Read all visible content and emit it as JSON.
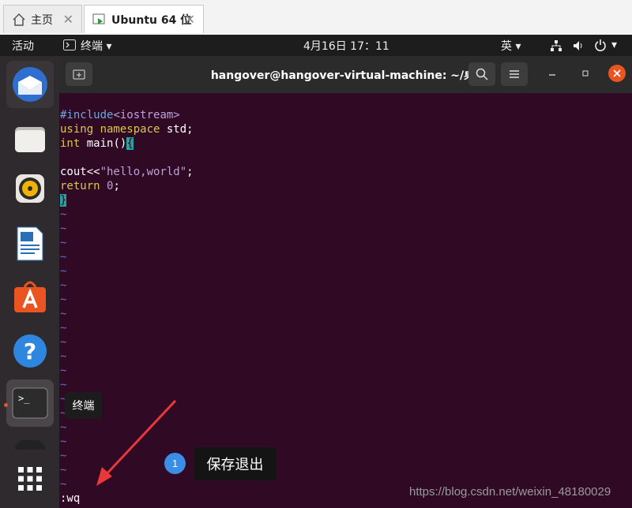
{
  "vmware": {
    "tabs": [
      {
        "label": "主页"
      },
      {
        "label": "Ubuntu 64 位"
      }
    ],
    "close_glyph": "✕"
  },
  "topbar": {
    "activities": "活动",
    "app_menu": "终端 ▾",
    "clock": "4月16日  17：11",
    "input_method": "英 ▾"
  },
  "dock": {
    "tooltip": "终端",
    "items": [
      {
        "icon": "thunderbird-icon"
      },
      {
        "icon": "files-icon"
      },
      {
        "icon": "rhythmbox-icon"
      },
      {
        "icon": "libreoffice-writer-icon"
      },
      {
        "icon": "software-center-icon"
      },
      {
        "icon": "help-icon"
      },
      {
        "icon": "terminal-icon"
      },
      {
        "icon": "show-apps-icon"
      }
    ]
  },
  "terminal": {
    "title": "hangover@hangover-virtual-machine: ~/桌面",
    "code": {
      "l1a": "#include",
      "l1b": "<iostream>",
      "l2a": "using namespace",
      "l2b": " std;",
      "l3a": "int",
      "l3b": " main()",
      "l3c": "{",
      "l5a": "cout<<",
      "l5b": "\"hello,world\"",
      "l5c": ";",
      "l6a": "return",
      "l6b": " 0",
      "l6c": ";",
      "l7": "}"
    },
    "tilde": "~",
    "command": ":wq"
  },
  "annotation": {
    "number": "1",
    "text": "保存退出"
  },
  "watermark": "https://blog.csdn.net/weixin_48180029",
  "colors": {
    "terminal_bg": "#300a24",
    "keyword": "#d8c84a",
    "preproc": "#6ea7dc",
    "string": "#bba2d8",
    "tilde": "#5d6fcf",
    "arrow": "#e8383a",
    "badge": "#3a8ee6"
  }
}
